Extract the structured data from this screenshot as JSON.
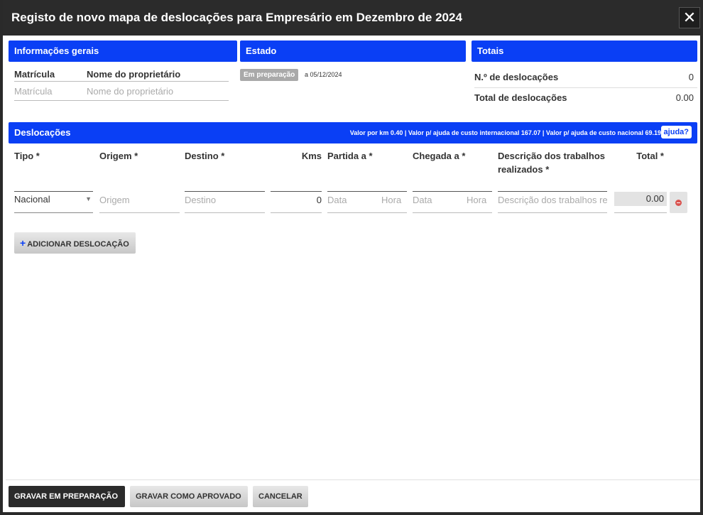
{
  "window": {
    "title": "Registo de novo mapa de deslocações para Empresário em Dezembro de 2024",
    "close_icon": "close-icon"
  },
  "general": {
    "heading": "Informações gerais",
    "matricula_label": "Matrícula",
    "matricula_placeholder": "Matrícula",
    "owner_label": "Nome do proprietário",
    "owner_placeholder": "Nome do proprietário"
  },
  "status": {
    "heading": "Estado",
    "badge": "Em preparação",
    "date": "a 05/12/2024"
  },
  "totals": {
    "heading": "Totais",
    "count_label": "N.º de deslocações",
    "count_value": "0",
    "total_label": "Total de deslocações",
    "total_value": "0.00"
  },
  "trips": {
    "heading": "Deslocações",
    "rates_info": "Valor por km 0.40  |  Valor p/ ajuda de custo internacional 167.07  |  Valor p/ ajuda de custo nacional 69.19",
    "help_label": "ajuda?",
    "columns": {
      "tipo": "Tipo *",
      "origem": "Origem *",
      "destino": "Destino *",
      "kms": "Kms",
      "partida": "Partida a *",
      "chegada": "Chegada a *",
      "descricao": "Descrição dos trabalhos realizados *",
      "total": "Total *"
    },
    "row": {
      "tipo_value": "Nacional",
      "origem_placeholder": "Origem",
      "destino_placeholder": "Destino",
      "kms_value": "0",
      "partida_data_placeholder": "Data",
      "partida_hora_placeholder": "Hora",
      "chegada_data_placeholder": "Data",
      "chegada_hora_placeholder": "Hora",
      "descricao_placeholder": "Descrição dos trabalhos re",
      "total_value": "0.00"
    },
    "add_label": "ADICIONAR DESLOCAÇÃO"
  },
  "footer": {
    "save_draft": "GRAVAR EM PREPARAÇÃO",
    "save_approved": "GRAVAR COMO APROVADO",
    "cancel": "CANCELAR"
  },
  "colors": {
    "accent": "#0a3ff5",
    "titlebar": "#2b2b2b",
    "remove": "#d9534f"
  }
}
